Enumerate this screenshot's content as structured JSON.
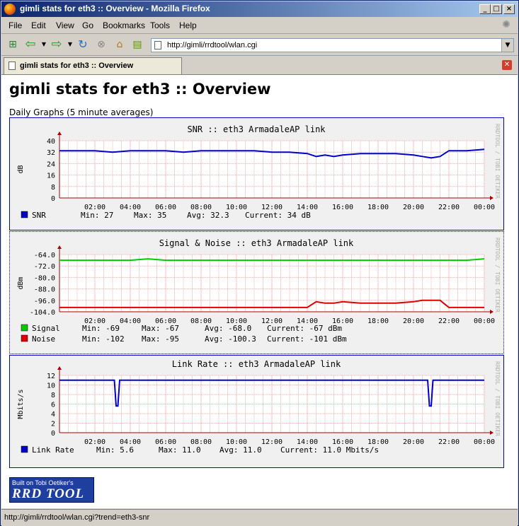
{
  "window": {
    "title": "gimli stats for eth3 :: Overview - Mozilla Firefox"
  },
  "menu": [
    "File",
    "Edit",
    "View",
    "Go",
    "Bookmarks",
    "Tools",
    "Help"
  ],
  "address": {
    "url": "http://gimli/rrdtool/wlan.cgi"
  },
  "tab": {
    "label": "gimli stats for eth3 :: Overview"
  },
  "page": {
    "heading": "gimli stats for eth3 :: Overview",
    "subtitle": "Daily Graphs (5 minute averages)"
  },
  "watermark": "RRDTOOL / TOBI OETIKER",
  "badge": {
    "line1": "Built on Tobi Oetiker's",
    "line2": "RRD TOOL"
  },
  "status": {
    "text": "http://gimli/rrdtool/wlan.cgi?trend=eth3-snr"
  },
  "colors": {
    "snr": "#0000cc",
    "signal": "#00cc00",
    "noise": "#dd0000",
    "rate": "#0000cc",
    "grid": "#ffaaaa",
    "axis": "#aa0000"
  },
  "chart_data": [
    {
      "type": "line",
      "title": "SNR :: eth3 ArmadaleAP link",
      "ylabel": "dB",
      "ylim": [
        0,
        40
      ],
      "yticks": [
        0,
        8,
        16,
        24,
        32,
        40
      ],
      "xticks": [
        "02:00",
        "04:00",
        "06:00",
        "08:00",
        "10:00",
        "12:00",
        "14:00",
        "16:00",
        "18:00",
        "20:00",
        "22:00",
        "00:00"
      ],
      "x": [
        0,
        1,
        2,
        3,
        4,
        5,
        6,
        7,
        8,
        9,
        10,
        11,
        12,
        13,
        14,
        14.5,
        15,
        15.5,
        16,
        17,
        18,
        19,
        20,
        20.5,
        21,
        21.5,
        22,
        23,
        24
      ],
      "series": [
        {
          "name": "SNR",
          "color": "#0000cc",
          "values": [
            33,
            33,
            33,
            32,
            33,
            33,
            33,
            32,
            33,
            33,
            33,
            33,
            32,
            32,
            31,
            29,
            30,
            29,
            30,
            31,
            31,
            31,
            30,
            29,
            28,
            29,
            33,
            33,
            34
          ],
          "stats": {
            "min": "27",
            "max": "35",
            "avg": "32.3",
            "current": "34",
            "unit": "dB"
          }
        }
      ]
    },
    {
      "type": "line",
      "title": "Signal & Noise :: eth3 ArmadaleAP link",
      "ylabel": "dBm",
      "ylim": [
        -104,
        -64
      ],
      "yticks": [
        -104.0,
        -96.0,
        -88.0,
        -80.0,
        -72.0,
        -64.0
      ],
      "xticks": [
        "02:00",
        "04:00",
        "06:00",
        "08:00",
        "10:00",
        "12:00",
        "14:00",
        "16:00",
        "18:00",
        "20:00",
        "22:00",
        "00:00"
      ],
      "x": [
        0,
        1,
        2,
        3,
        4,
        5,
        6,
        7,
        8,
        9,
        10,
        11,
        12,
        13,
        14,
        14.5,
        15,
        15.5,
        16,
        17,
        18,
        19,
        20,
        20.5,
        21,
        21.5,
        22,
        23,
        24
      ],
      "series": [
        {
          "name": "Signal",
          "color": "#00cc00",
          "values": [
            -68,
            -68,
            -68,
            -68,
            -68,
            -67,
            -68,
            -68,
            -68,
            -68,
            -68,
            -68,
            -68,
            -68,
            -68,
            -68,
            -68,
            -68,
            -68,
            -68,
            -68,
            -68,
            -68,
            -68,
            -68,
            -68,
            -68,
            -68,
            -67
          ],
          "stats": {
            "min": "-69",
            "max": "-67",
            "avg": "-68.0",
            "current": "-67",
            "unit": "dBm"
          }
        },
        {
          "name": "Noise",
          "color": "#dd0000",
          "values": [
            -101,
            -101,
            -101,
            -101,
            -101,
            -101,
            -101,
            -101,
            -101,
            -101,
            -101,
            -101,
            -101,
            -101,
            -101,
            -97,
            -98,
            -98,
            -97,
            -98,
            -98,
            -98,
            -97,
            -96,
            -96,
            -96,
            -101,
            -101,
            -101
          ],
          "stats": {
            "min": "-102",
            "max": "-95",
            "avg": "-100.3",
            "current": "-101",
            "unit": "dBm"
          }
        }
      ]
    },
    {
      "type": "line",
      "title": "Link Rate :: eth3 ArmadaleAP link",
      "ylabel": "Mbits/s",
      "ylim": [
        0,
        12
      ],
      "yticks": [
        0,
        2,
        4,
        6,
        8,
        10,
        12
      ],
      "xticks": [
        "02:00",
        "04:00",
        "06:00",
        "08:00",
        "10:00",
        "12:00",
        "14:00",
        "16:00",
        "18:00",
        "20:00",
        "22:00",
        "00:00"
      ],
      "x": [
        0,
        3.1,
        3.2,
        3.3,
        3.4,
        3.5,
        20.8,
        20.9,
        21.0,
        21.1,
        21.2,
        24
      ],
      "series": [
        {
          "name": "Link Rate",
          "color": "#0000cc",
          "values": [
            11,
            11,
            5.6,
            5.6,
            11,
            11,
            11,
            5.6,
            5.6,
            11,
            11,
            11
          ],
          "stats": {
            "min": "5.6",
            "max": "11.0",
            "avg": "11.0",
            "current": "11.0",
            "unit": "Mbits/s"
          }
        }
      ]
    }
  ]
}
